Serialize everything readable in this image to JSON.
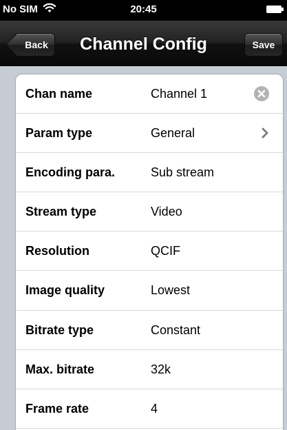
{
  "status_bar": {
    "carrier": "No SIM",
    "time": "20:45",
    "wifi_icon": "wifi-icon",
    "battery_icon": "battery-icon"
  },
  "nav": {
    "title": "Channel Config",
    "back_label": "Back",
    "save_label": "Save"
  },
  "rows": [
    {
      "label": "Chan name",
      "value": "Channel 1",
      "accessory": "clear-icon"
    },
    {
      "label": "Param type",
      "value": "General",
      "accessory": "chevron-right-icon"
    },
    {
      "label": "Encoding para.",
      "value": "Sub stream"
    },
    {
      "label": "Stream type",
      "value": "Video"
    },
    {
      "label": "Resolution",
      "value": "QCIF"
    },
    {
      "label": "Image quality",
      "value": "Lowest"
    },
    {
      "label": "Bitrate type",
      "value": "Constant"
    },
    {
      "label": "Max. bitrate",
      "value": "32k"
    },
    {
      "label": "Frame rate",
      "value": "4"
    }
  ],
  "colors": {
    "background": "#c5ccd4",
    "navbar": "#1c1c1c",
    "card": "#ffffff",
    "separator": "#d9d9d9"
  }
}
